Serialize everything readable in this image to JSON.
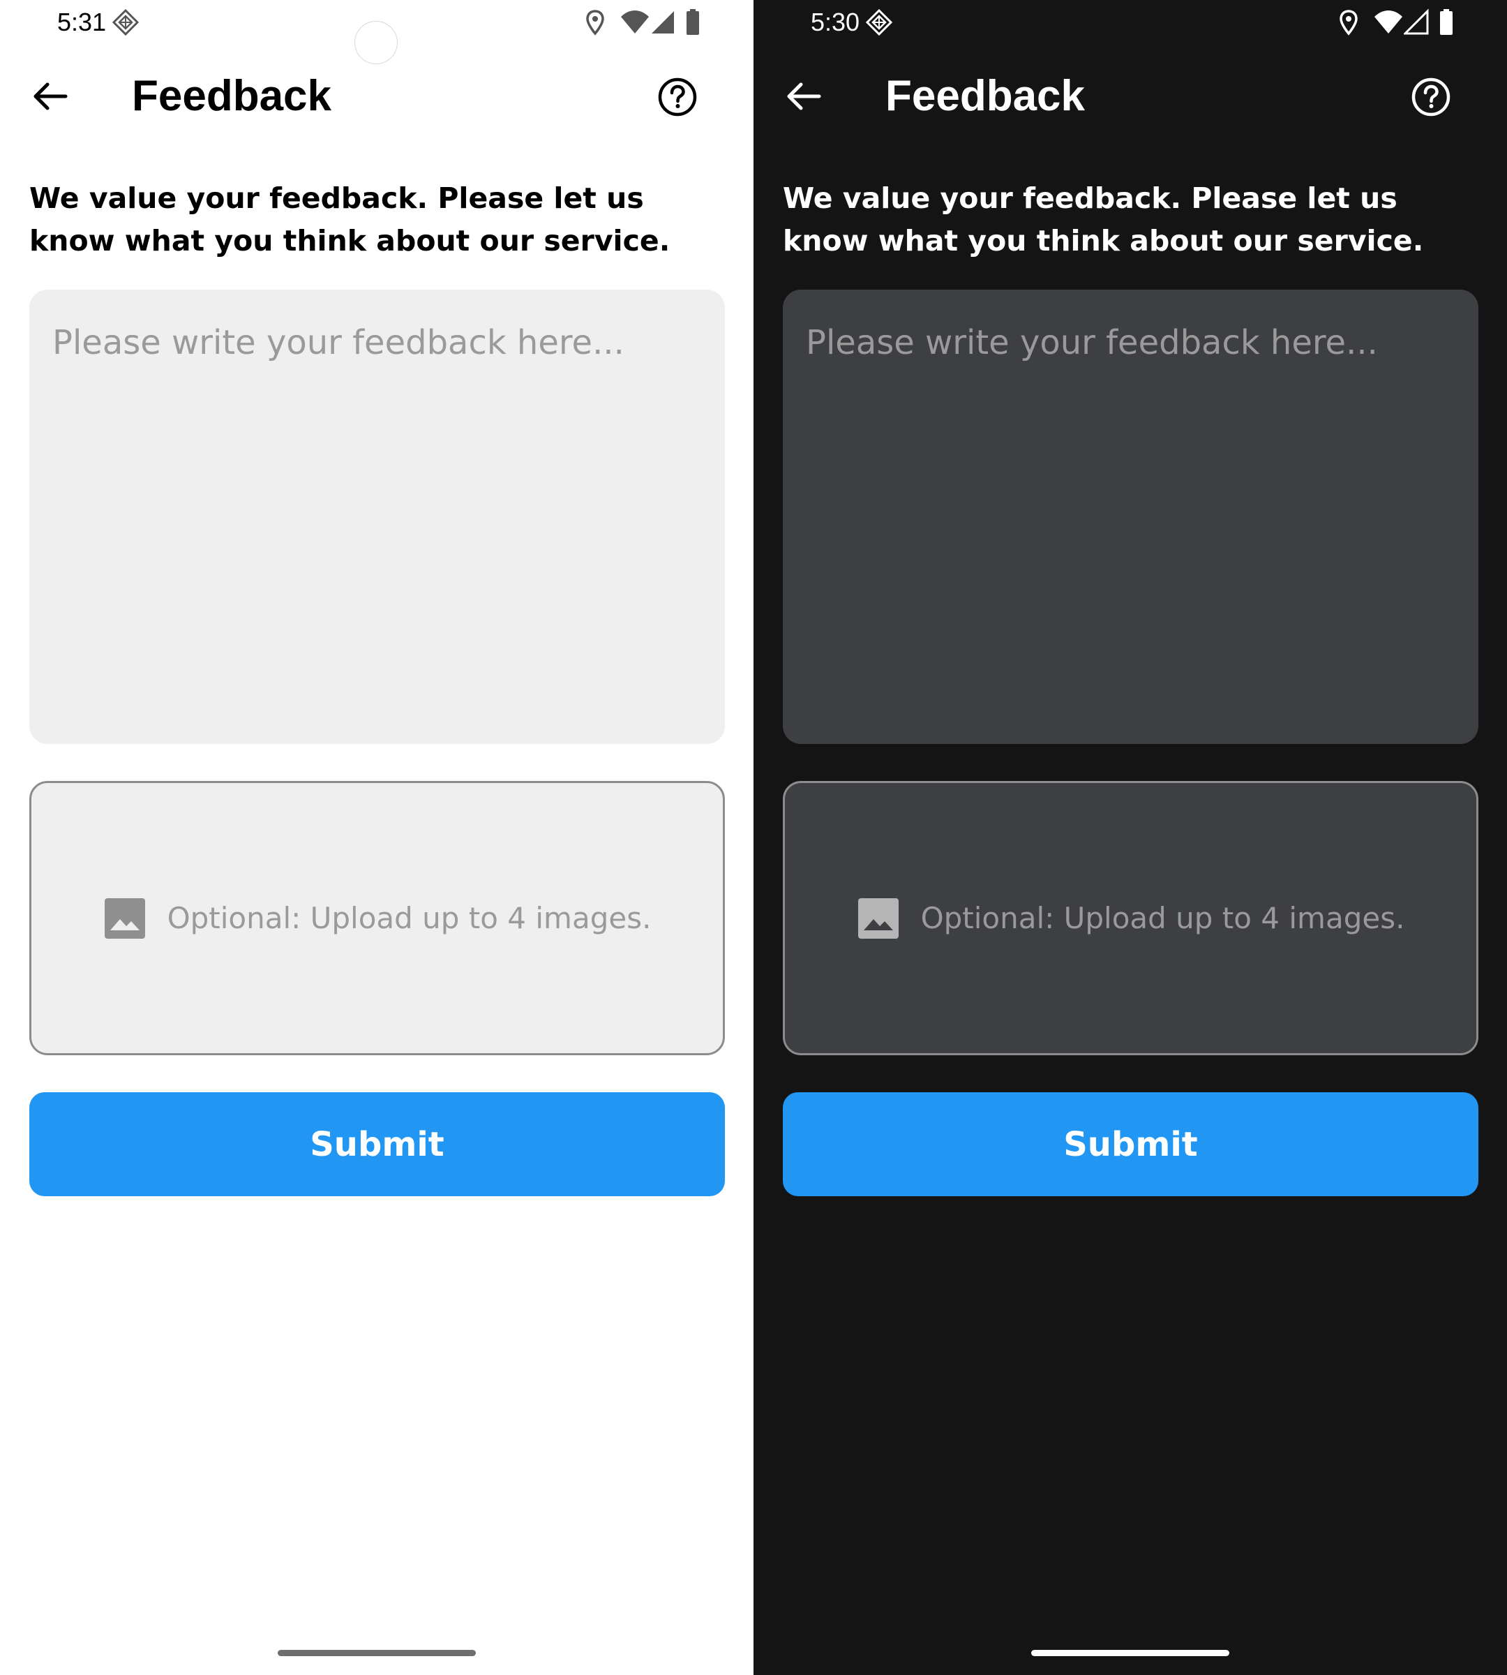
{
  "screens": [
    {
      "theme": "light",
      "status_bar": {
        "time": "5:31"
      },
      "header": {
        "title": "Feedback"
      },
      "intro_text": "We value your feedback. Please let us know what you think about our service.",
      "feedback_input": {
        "placeholder": "Please write your feedback here...",
        "value": ""
      },
      "upload": {
        "label": "Optional: Upload up to 4 images."
      },
      "submit_label": "Submit"
    },
    {
      "theme": "dark",
      "status_bar": {
        "time": "5:30"
      },
      "header": {
        "title": "Feedback"
      },
      "intro_text": "We value your feedback. Please let us know what you think about our service.",
      "feedback_input": {
        "placeholder": "Please write your feedback here...",
        "value": ""
      },
      "upload": {
        "label": "Optional: Upload up to 4 images."
      },
      "submit_label": "Submit"
    }
  ],
  "icons": {
    "status_left": "app-diamond-icon",
    "status_right": [
      "location-pin-icon",
      "wifi-icon",
      "cell-signal-icon",
      "battery-icon"
    ],
    "back": "arrow-back-icon",
    "help": "help-circle-icon",
    "upload": "image-icon"
  },
  "colors": {
    "accent": "#2196f3",
    "light_field_bg": "#efefef",
    "dark_bg": "#141414",
    "dark_field_bg": "#3e3f42",
    "placeholder": "#9a9a9a"
  }
}
